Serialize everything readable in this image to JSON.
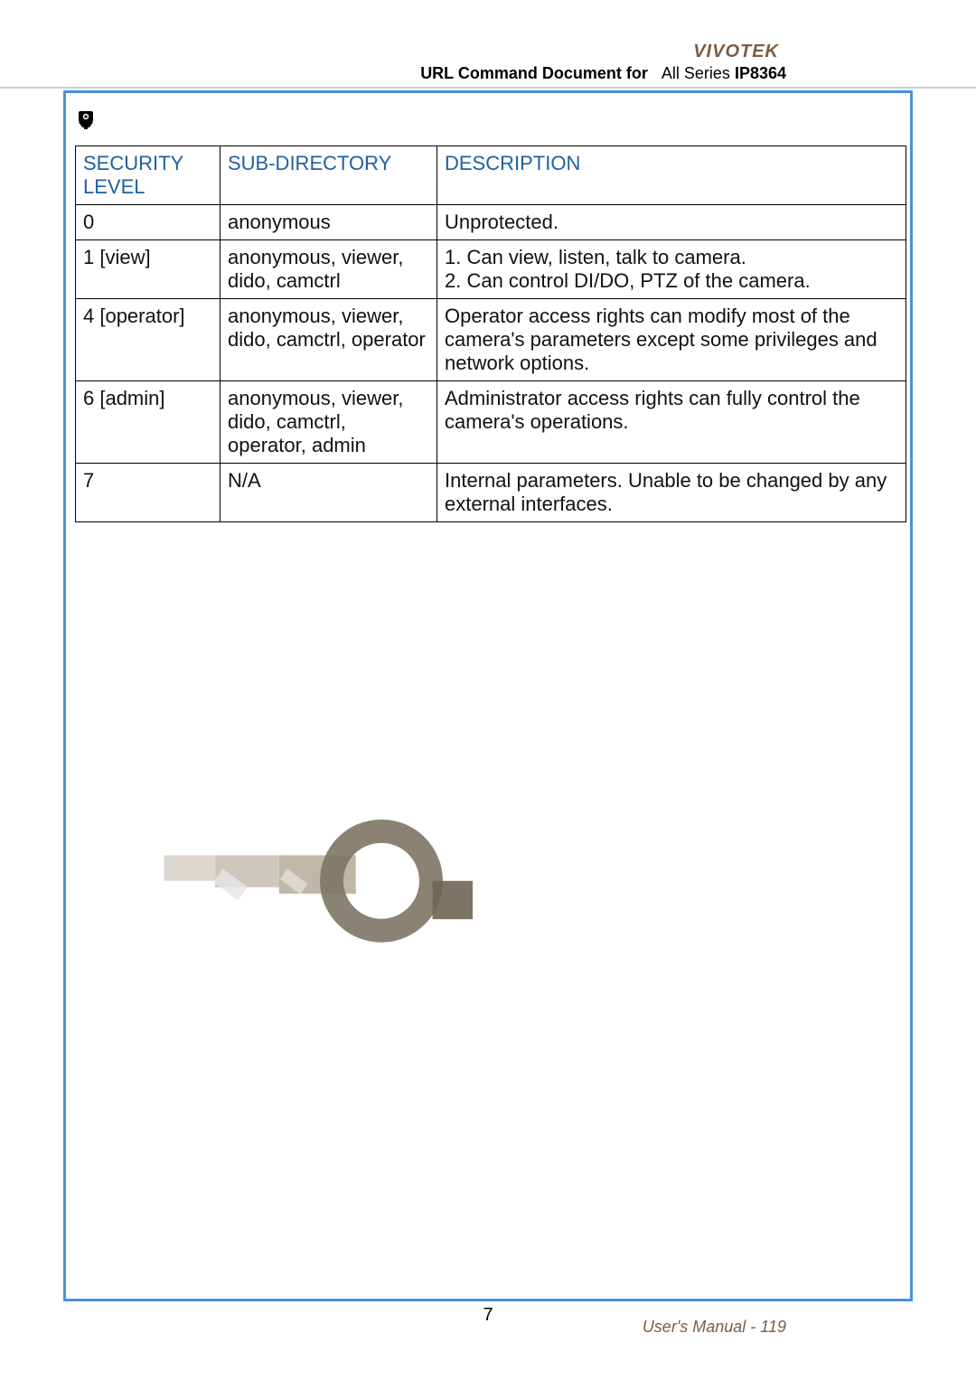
{
  "header": {
    "brand": "VIVOTEK",
    "doc_title_prefix": "URL Command Document for",
    "doc_title_thin": "All Series",
    "doc_title_model": "IP8364"
  },
  "table": {
    "headers": {
      "level": "SECURITY LEVEL",
      "sub": "SUB-DIRECTORY",
      "desc": "DESCRIPTION"
    },
    "rows": [
      {
        "level": "0",
        "sub": "anonymous",
        "desc": "Unprotected."
      },
      {
        "level": "1 [view]",
        "sub": "anonymous, viewer, dido, camctrl",
        "desc": "1. Can view, listen, talk to camera.\n2. Can control DI/DO, PTZ of the camera."
      },
      {
        "level": "4 [operator]",
        "sub": "anonymous, viewer, dido, camctrl, operator",
        "desc": "Operator access rights can modify most of the camera's parameters except some privileges and network options."
      },
      {
        "level": "6 [admin]",
        "sub": "anonymous, viewer, dido, camctrl, operator, admin",
        "desc": "Administrator access rights can fully control the camera's operations."
      },
      {
        "level": "7",
        "sub": "N/A",
        "desc": "Internal parameters. Unable to be changed by any external interfaces."
      }
    ]
  },
  "footer": {
    "page_num": "7",
    "manual_label": "User's Manual - ",
    "manual_page": "119"
  },
  "icons": {
    "camera": "camera-icon"
  }
}
